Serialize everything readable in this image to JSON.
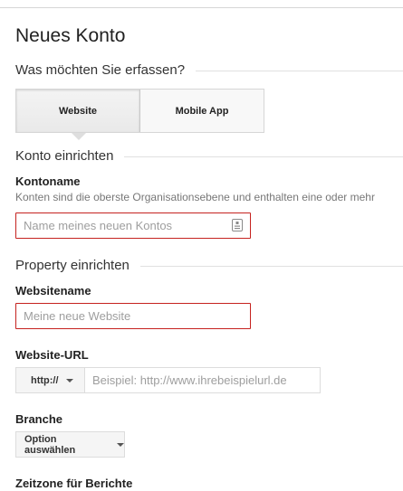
{
  "page": {
    "title": "Neues Konto"
  },
  "tracking": {
    "question": "Was möchten Sie erfassen?",
    "options": [
      {
        "label": "Website",
        "selected": true
      },
      {
        "label": "Mobile App",
        "selected": false
      }
    ]
  },
  "account": {
    "section_title": "Konto einrichten",
    "name_label": "Kontoname",
    "name_help": "Konten sind die oberste Organisationsebene und enthalten eine oder mehr",
    "name_placeholder": "Name meines neuen Kontos",
    "name_value": "",
    "field_icon": "contact-card-icon"
  },
  "property": {
    "section_title": "Property einrichten",
    "website_name_label": "Websitename",
    "website_name_placeholder": "Meine neue Website",
    "website_name_value": "",
    "url_label": "Website-URL",
    "protocol_selected": "http://",
    "url_placeholder": "Beispiel: http://www.ihrebeispielurl.de",
    "url_value": "",
    "industry_label": "Branche",
    "industry_selected": "Option auswählen",
    "timezone_label": "Zeitzone für Berichte"
  },
  "colors": {
    "error_border": "#c5221f",
    "help_text": "#777777",
    "divider": "#e0e0e0"
  }
}
